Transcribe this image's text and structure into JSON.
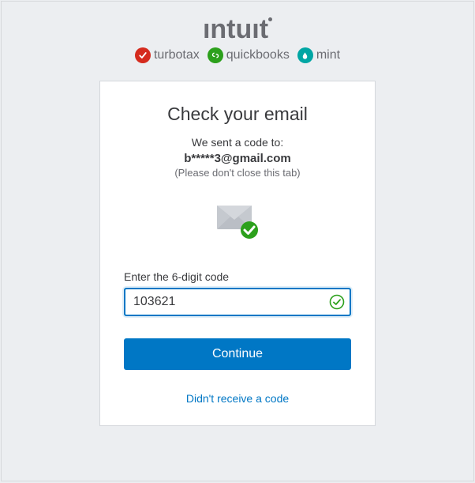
{
  "brand": {
    "logo_text": "ıntuıt",
    "products": [
      {
        "icon": "check",
        "label": "turbotax"
      },
      {
        "icon": "qb",
        "label": "quickbooks"
      },
      {
        "icon": "drop",
        "label": "mint"
      }
    ]
  },
  "card": {
    "title": "Check your email",
    "sent_text": "We sent a code to:",
    "email": "b*****3@gmail.com",
    "hint": "(Please don't close this tab)",
    "input_label": "Enter the 6-digit code",
    "code_value": "103621",
    "continue_label": "Continue",
    "resend_label": "Didn't receive a code"
  },
  "colors": {
    "primary": "#0077c5",
    "success": "#2ca01c"
  }
}
